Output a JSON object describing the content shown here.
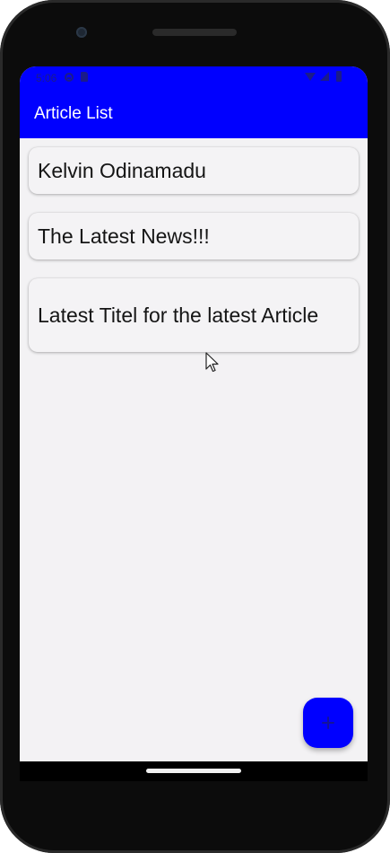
{
  "status_bar": {
    "time": "5:06",
    "icons": [
      "do-not-disturb-icon",
      "sd-card-icon",
      "wifi-icon",
      "signal-icon",
      "battery-icon"
    ]
  },
  "app_bar": {
    "title": "Article List"
  },
  "articles": [
    {
      "title": "Kelvin Odinamadu"
    },
    {
      "title": "The Latest News!!!"
    },
    {
      "title": "Latest Titel for the latest Article"
    }
  ],
  "fab": {
    "icon": "plus-icon"
  },
  "colors": {
    "primary": "#0000ff",
    "background": "#f3f2f4",
    "card_background": "#f4f3f5",
    "text": "#151515",
    "on_primary": "#ffffff"
  }
}
